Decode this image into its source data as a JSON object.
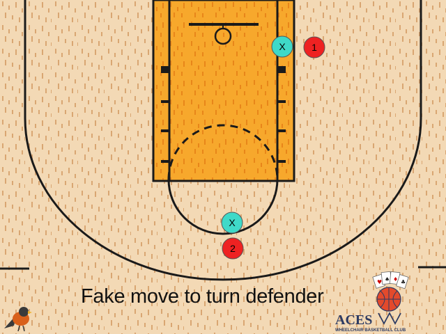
{
  "caption": "Fake move to turn defender",
  "players": [
    {
      "label": "X",
      "role": "defender",
      "color": "#3fd9c8"
    },
    {
      "label": "1",
      "role": "offense",
      "color": "#ee2222"
    },
    {
      "label": "X",
      "role": "defender",
      "color": "#3fd9c8"
    },
    {
      "label": "2",
      "role": "offense",
      "color": "#ee2222"
    }
  ],
  "logo": {
    "name": "ACES",
    "subtitle": "WHEELCHAIR BASKETBALL CLUB"
  },
  "colors": {
    "floor": "#f3d9b5",
    "paint": "#f7a82c",
    "lines": "#1a1a1a"
  }
}
